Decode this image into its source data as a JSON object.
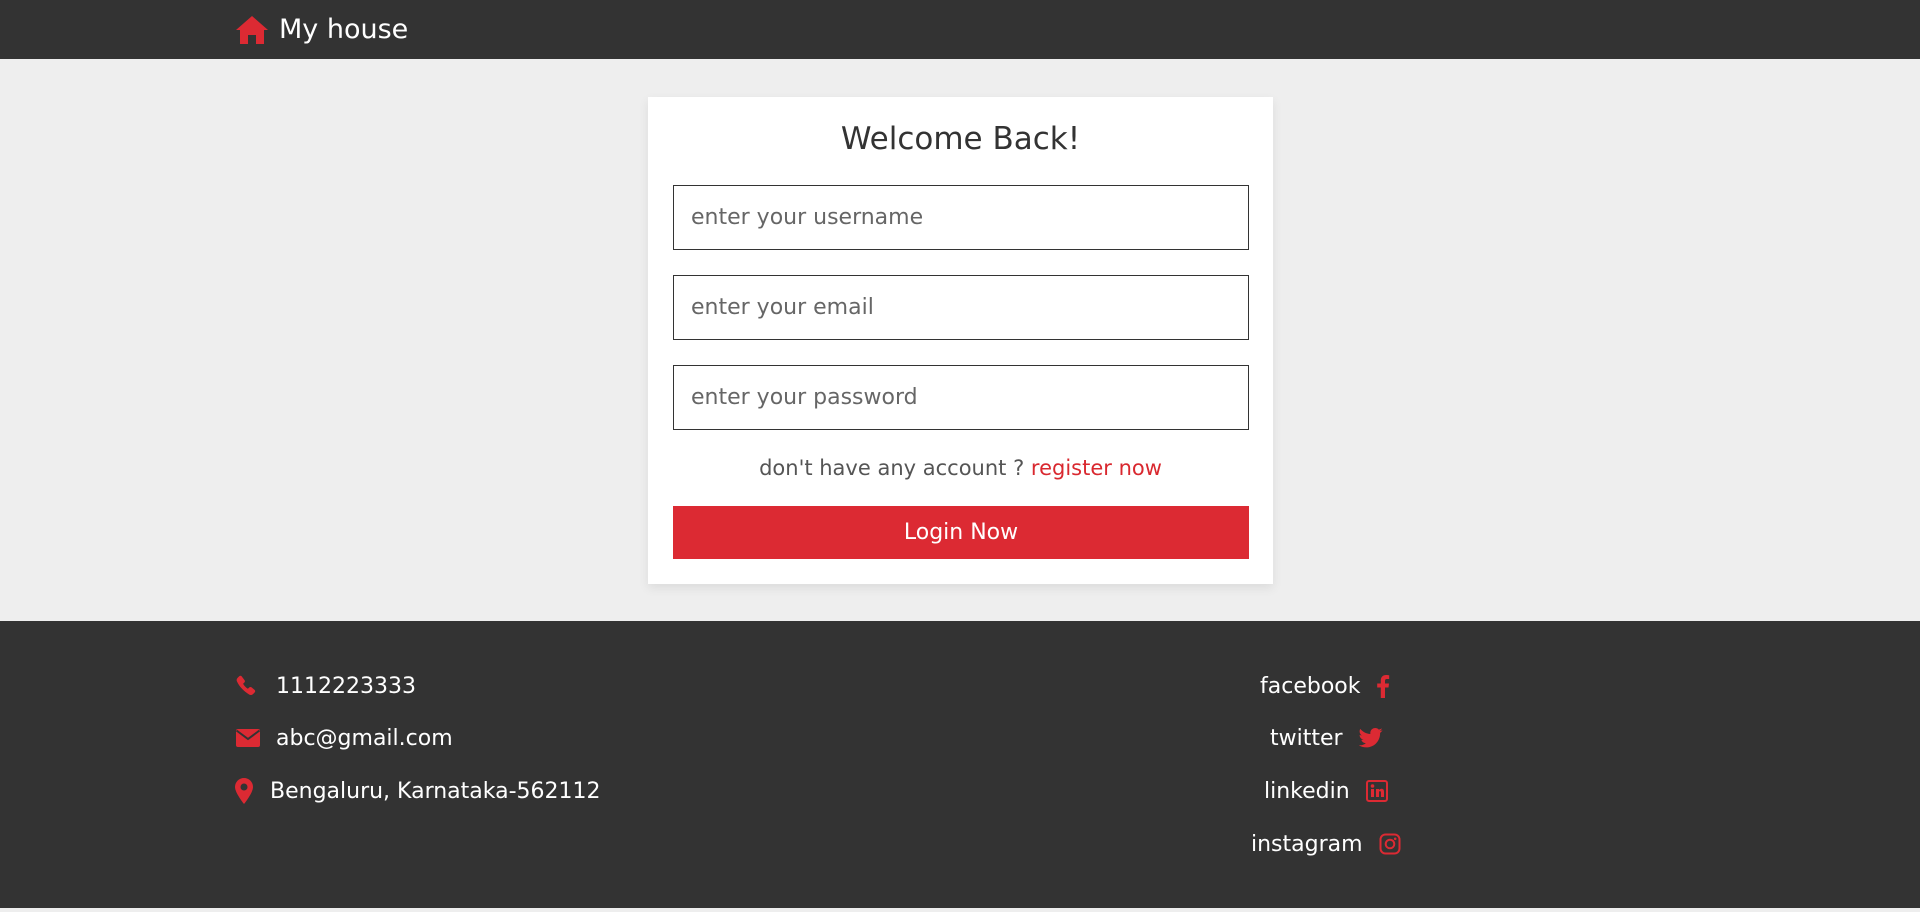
{
  "header": {
    "logo_icon": "home-icon",
    "logo_text": "My house"
  },
  "login": {
    "title": "Welcome Back!",
    "username_placeholder": "enter your username",
    "email_placeholder": "enter your email",
    "password_placeholder": "enter your password",
    "register_prompt": "don't have any account ?",
    "register_link": "register now",
    "login_button": "Login Now"
  },
  "footer": {
    "contacts": [
      {
        "icon": "phone-icon",
        "text": "1112223333"
      },
      {
        "icon": "envelope-icon",
        "text": "abc@gmail.com"
      },
      {
        "icon": "map-marker-icon",
        "text": "Bengaluru, Karnataka-562112"
      }
    ],
    "social": [
      {
        "icon": "facebook-icon",
        "text": "facebook"
      },
      {
        "icon": "twitter-icon",
        "text": "twitter"
      },
      {
        "icon": "linkedin-icon",
        "text": "linkedin"
      },
      {
        "icon": "instagram-icon",
        "text": "instagram"
      }
    ]
  },
  "colors": {
    "accent": "#dc2a33",
    "dark": "#333333",
    "background": "#eeeeee"
  }
}
